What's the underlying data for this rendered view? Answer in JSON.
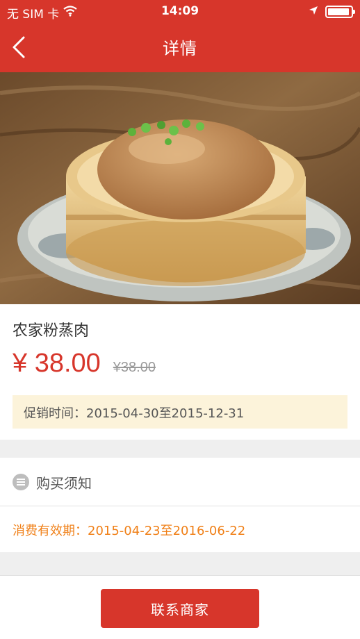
{
  "status_bar": {
    "carrier": "无 SIM 卡",
    "time": "14:09"
  },
  "nav": {
    "title": "详情"
  },
  "product": {
    "name": "农家粉蒸肉",
    "price": "¥ 38.00",
    "original_price": "¥38.00",
    "promo": "促销时间：2015-04-30至2015-12-31"
  },
  "notice": {
    "label": "购买须知",
    "validity": "消费有效期：2015-04-23至2016-06-22"
  },
  "actions": {
    "contact": "联系商家"
  },
  "colors": {
    "brand": "#d7362b",
    "promo_bg": "#fcf3da",
    "validity_text": "#f08018"
  },
  "icons": [
    "back-chevron-icon",
    "wifi-icon",
    "location-arrow-icon",
    "battery-icon",
    "list-icon"
  ]
}
